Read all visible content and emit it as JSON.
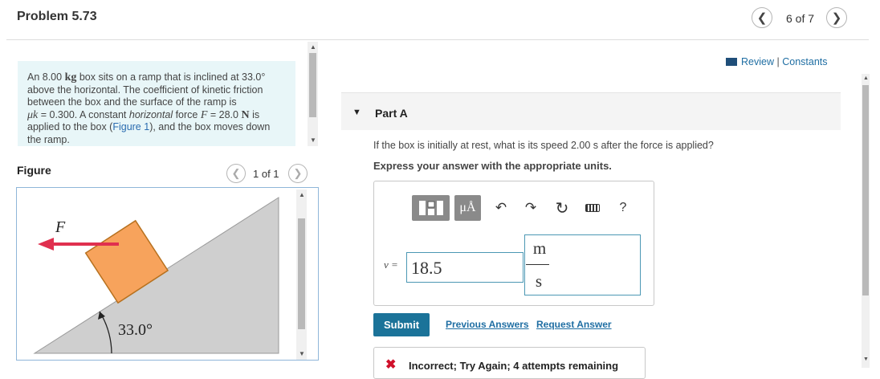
{
  "header": {
    "title": "Problem 5.73",
    "pager": "6 of 7"
  },
  "problem": {
    "t1": "An 8.00 ",
    "mass_unit": "kg",
    "t2": " box sits on a ramp that is inclined at 33.0°",
    "t3": "above the horizontal. The coefficient of kinetic friction",
    "t4": "between the box and the surface of the ramp is",
    "mu_symbol": "μk",
    "t5": " = 0.300. A constant ",
    "horizontal_word": "horizontal",
    "t6": " force ",
    "force_symbol": "F",
    "t7": " = 28.0 ",
    "force_unit": "N",
    "t8": " is",
    "t9": "applied to the box (",
    "figure_link": "Figure 1",
    "t10": "), and the box moves down",
    "t11": "the ramp."
  },
  "figure": {
    "label": "Figure",
    "pager": "1 of 1",
    "force_label": "F",
    "angle_label": "33.0°"
  },
  "links": {
    "review": "Review",
    "separator": "|",
    "constants": "Constants"
  },
  "part": {
    "label": "Part A",
    "question": "If the box is initially at rest, what is its speed 2.00 s after the force is applied?",
    "instruction": "Express your answer with the appropriate units."
  },
  "answer": {
    "var_label": "v =",
    "value": "18.5",
    "unit_numerator": "m",
    "unit_denominator": "s",
    "toolbar_units": "μÅ",
    "toolbar_help": "?"
  },
  "actions": {
    "submit": "Submit",
    "previous_answers": "Previous Answers",
    "request_answer": "Request Answer"
  },
  "feedback": {
    "message": "Incorrect; Try Again; 4 attempts remaining"
  },
  "colors": {
    "box_fill": "#f7a35c",
    "arrow": "#e0304f",
    "ramp": "#cfcfcf",
    "submit": "#1b7399",
    "problem_bg": "#e8f6f8"
  }
}
